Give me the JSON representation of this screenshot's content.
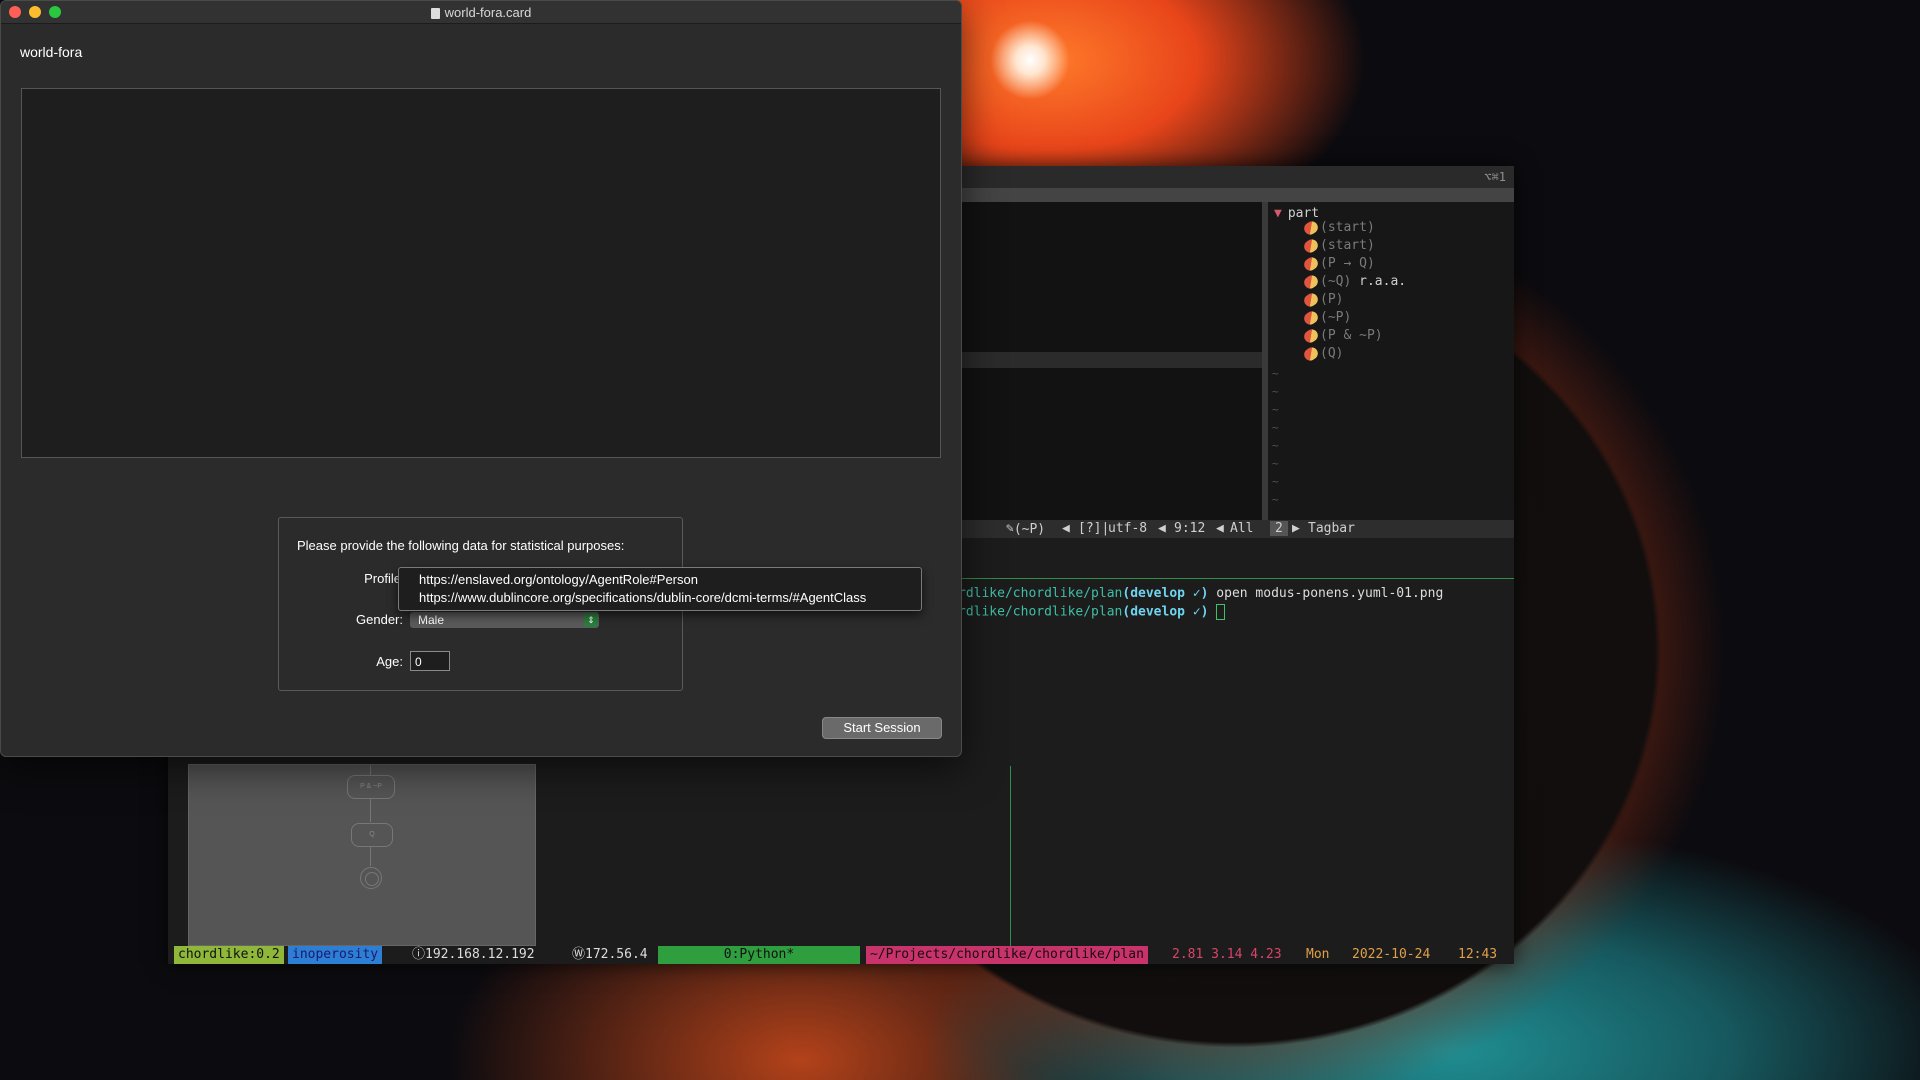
{
  "window": {
    "title": "world-fora.card",
    "app_name": "world-fora",
    "form": {
      "prompt": "Please provide the following data for statistical purposes:",
      "profile_label": "Profile",
      "profile_options": [
        "https://enslaved.org/ontology/AgentRole#Person",
        "https://www.dublincore.org/specifications/dublin-core/dcmi-terms/#AgentClass"
      ],
      "gender_label": "Gender:",
      "gender_value": "Male",
      "age_label": "Age:",
      "age_value": "0"
    },
    "start_button": "Start Session"
  },
  "terminal": {
    "title_shortcut": "⌥⌘1",
    "tagbar": {
      "header": "part",
      "items": [
        {
          "label": "(start)",
          "extra": ""
        },
        {
          "label": "(start)",
          "extra": ""
        },
        {
          "label": "(P → Q)",
          "extra": ""
        },
        {
          "label": "(~Q)",
          "extra": " r.a.a."
        },
        {
          "label": "(P)",
          "extra": ""
        },
        {
          "label": "(~P)",
          "extra": ""
        },
        {
          "label": "(P & ~P)",
          "extra": ""
        },
        {
          "label": "(Q)",
          "extra": ""
        }
      ]
    },
    "vim_status": {
      "tag": "(~P)",
      "flag": "[?]|",
      "encoding": "utf-8",
      "position": "9:12",
      "scroll": "All",
      "window_num": "2",
      "plugin": "Tagbar"
    },
    "shell_lines": [
      {
        "path": "rdlike/chordlike/plan",
        "branch": "(develop ✓)",
        "cmd": " open modus-ponens.yuml-01.png"
      },
      {
        "path": "rdlike/chordlike/plan",
        "branch": "(develop ✓)",
        "cmd": " "
      }
    ],
    "image_nodes": [
      "P & ~P",
      "Q"
    ],
    "tmux": {
      "session": "chordlike:0.2",
      "host": "inoperosity",
      "ip_local": "ⓘ192.168.12.192",
      "ip_wan": "Ⓦ172.56.4",
      "window": "0:Python*",
      "path": "~/Projects/chordlike/chordlike/plan",
      "load": "2.81 3.14 4.23",
      "day": "Mon",
      "date": "2022-10-24",
      "time": "12:43"
    }
  }
}
